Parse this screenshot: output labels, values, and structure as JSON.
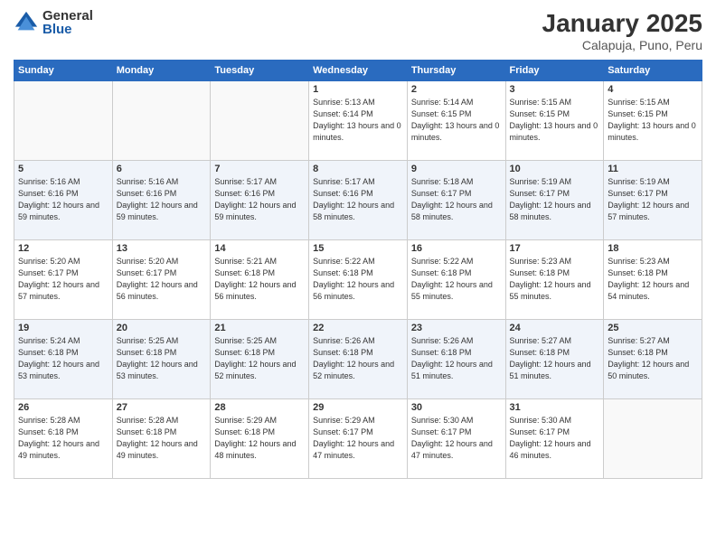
{
  "logo": {
    "general": "General",
    "blue": "Blue"
  },
  "header": {
    "title": "January 2025",
    "subtitle": "Calapuja, Puno, Peru"
  },
  "weekdays": [
    "Sunday",
    "Monday",
    "Tuesday",
    "Wednesday",
    "Thursday",
    "Friday",
    "Saturday"
  ],
  "weeks": [
    [
      {
        "day": "",
        "sunrise": "",
        "sunset": "",
        "daylight": ""
      },
      {
        "day": "",
        "sunrise": "",
        "sunset": "",
        "daylight": ""
      },
      {
        "day": "",
        "sunrise": "",
        "sunset": "",
        "daylight": ""
      },
      {
        "day": "1",
        "sunrise": "Sunrise: 5:13 AM",
        "sunset": "Sunset: 6:14 PM",
        "daylight": "Daylight: 13 hours and 0 minutes."
      },
      {
        "day": "2",
        "sunrise": "Sunrise: 5:14 AM",
        "sunset": "Sunset: 6:15 PM",
        "daylight": "Daylight: 13 hours and 0 minutes."
      },
      {
        "day": "3",
        "sunrise": "Sunrise: 5:15 AM",
        "sunset": "Sunset: 6:15 PM",
        "daylight": "Daylight: 13 hours and 0 minutes."
      },
      {
        "day": "4",
        "sunrise": "Sunrise: 5:15 AM",
        "sunset": "Sunset: 6:15 PM",
        "daylight": "Daylight: 13 hours and 0 minutes."
      }
    ],
    [
      {
        "day": "5",
        "sunrise": "Sunrise: 5:16 AM",
        "sunset": "Sunset: 6:16 PM",
        "daylight": "Daylight: 12 hours and 59 minutes."
      },
      {
        "day": "6",
        "sunrise": "Sunrise: 5:16 AM",
        "sunset": "Sunset: 6:16 PM",
        "daylight": "Daylight: 12 hours and 59 minutes."
      },
      {
        "day": "7",
        "sunrise": "Sunrise: 5:17 AM",
        "sunset": "Sunset: 6:16 PM",
        "daylight": "Daylight: 12 hours and 59 minutes."
      },
      {
        "day": "8",
        "sunrise": "Sunrise: 5:17 AM",
        "sunset": "Sunset: 6:16 PM",
        "daylight": "Daylight: 12 hours and 58 minutes."
      },
      {
        "day": "9",
        "sunrise": "Sunrise: 5:18 AM",
        "sunset": "Sunset: 6:17 PM",
        "daylight": "Daylight: 12 hours and 58 minutes."
      },
      {
        "day": "10",
        "sunrise": "Sunrise: 5:19 AM",
        "sunset": "Sunset: 6:17 PM",
        "daylight": "Daylight: 12 hours and 58 minutes."
      },
      {
        "day": "11",
        "sunrise": "Sunrise: 5:19 AM",
        "sunset": "Sunset: 6:17 PM",
        "daylight": "Daylight: 12 hours and 57 minutes."
      }
    ],
    [
      {
        "day": "12",
        "sunrise": "Sunrise: 5:20 AM",
        "sunset": "Sunset: 6:17 PM",
        "daylight": "Daylight: 12 hours and 57 minutes."
      },
      {
        "day": "13",
        "sunrise": "Sunrise: 5:20 AM",
        "sunset": "Sunset: 6:17 PM",
        "daylight": "Daylight: 12 hours and 56 minutes."
      },
      {
        "day": "14",
        "sunrise": "Sunrise: 5:21 AM",
        "sunset": "Sunset: 6:18 PM",
        "daylight": "Daylight: 12 hours and 56 minutes."
      },
      {
        "day": "15",
        "sunrise": "Sunrise: 5:22 AM",
        "sunset": "Sunset: 6:18 PM",
        "daylight": "Daylight: 12 hours and 56 minutes."
      },
      {
        "day": "16",
        "sunrise": "Sunrise: 5:22 AM",
        "sunset": "Sunset: 6:18 PM",
        "daylight": "Daylight: 12 hours and 55 minutes."
      },
      {
        "day": "17",
        "sunrise": "Sunrise: 5:23 AM",
        "sunset": "Sunset: 6:18 PM",
        "daylight": "Daylight: 12 hours and 55 minutes."
      },
      {
        "day": "18",
        "sunrise": "Sunrise: 5:23 AM",
        "sunset": "Sunset: 6:18 PM",
        "daylight": "Daylight: 12 hours and 54 minutes."
      }
    ],
    [
      {
        "day": "19",
        "sunrise": "Sunrise: 5:24 AM",
        "sunset": "Sunset: 6:18 PM",
        "daylight": "Daylight: 12 hours and 53 minutes."
      },
      {
        "day": "20",
        "sunrise": "Sunrise: 5:25 AM",
        "sunset": "Sunset: 6:18 PM",
        "daylight": "Daylight: 12 hours and 53 minutes."
      },
      {
        "day": "21",
        "sunrise": "Sunrise: 5:25 AM",
        "sunset": "Sunset: 6:18 PM",
        "daylight": "Daylight: 12 hours and 52 minutes."
      },
      {
        "day": "22",
        "sunrise": "Sunrise: 5:26 AM",
        "sunset": "Sunset: 6:18 PM",
        "daylight": "Daylight: 12 hours and 52 minutes."
      },
      {
        "day": "23",
        "sunrise": "Sunrise: 5:26 AM",
        "sunset": "Sunset: 6:18 PM",
        "daylight": "Daylight: 12 hours and 51 minutes."
      },
      {
        "day": "24",
        "sunrise": "Sunrise: 5:27 AM",
        "sunset": "Sunset: 6:18 PM",
        "daylight": "Daylight: 12 hours and 51 minutes."
      },
      {
        "day": "25",
        "sunrise": "Sunrise: 5:27 AM",
        "sunset": "Sunset: 6:18 PM",
        "daylight": "Daylight: 12 hours and 50 minutes."
      }
    ],
    [
      {
        "day": "26",
        "sunrise": "Sunrise: 5:28 AM",
        "sunset": "Sunset: 6:18 PM",
        "daylight": "Daylight: 12 hours and 49 minutes."
      },
      {
        "day": "27",
        "sunrise": "Sunrise: 5:28 AM",
        "sunset": "Sunset: 6:18 PM",
        "daylight": "Daylight: 12 hours and 49 minutes."
      },
      {
        "day": "28",
        "sunrise": "Sunrise: 5:29 AM",
        "sunset": "Sunset: 6:18 PM",
        "daylight": "Daylight: 12 hours and 48 minutes."
      },
      {
        "day": "29",
        "sunrise": "Sunrise: 5:29 AM",
        "sunset": "Sunset: 6:17 PM",
        "daylight": "Daylight: 12 hours and 47 minutes."
      },
      {
        "day": "30",
        "sunrise": "Sunrise: 5:30 AM",
        "sunset": "Sunset: 6:17 PM",
        "daylight": "Daylight: 12 hours and 47 minutes."
      },
      {
        "day": "31",
        "sunrise": "Sunrise: 5:30 AM",
        "sunset": "Sunset: 6:17 PM",
        "daylight": "Daylight: 12 hours and 46 minutes."
      },
      {
        "day": "",
        "sunrise": "",
        "sunset": "",
        "daylight": ""
      }
    ]
  ]
}
